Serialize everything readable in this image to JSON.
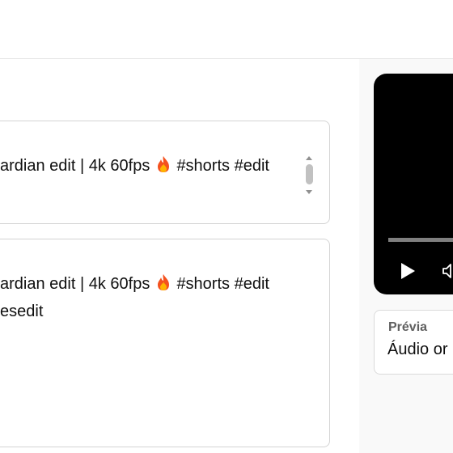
{
  "title_field": {
    "line1": "ardian edit | 4k 60fps",
    "line1_tags": "#shorts #edit"
  },
  "description_field": {
    "line1": "ardian edit | 4k 60fps",
    "line1_tags": "#shorts #edit",
    "line2": "esedit"
  },
  "preview": {
    "label": "Prévia",
    "value": "Áudio or"
  },
  "icons": {
    "emoji": "fire-emoji-icon",
    "play": "play-icon",
    "volume": "volume-icon"
  },
  "colors": {
    "field_border": "#d3d3d3",
    "panel_bg": "#f9f9f9",
    "video_bg": "#000000"
  }
}
